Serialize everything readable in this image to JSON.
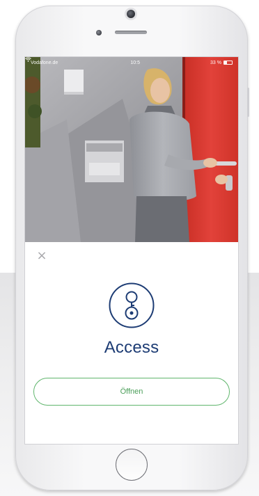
{
  "status_bar": {
    "carrier": "Vodafone.de",
    "wifi_icon": "wifi-icon",
    "time": "10:5",
    "battery_percent": "33 %",
    "battery_level": 0.33
  },
  "dialog": {
    "close_label": "×",
    "key_icon": "key-icon",
    "title": "Access",
    "open_button_label": "Öffnen"
  },
  "colors": {
    "title": "#1d3c74",
    "accent_green": "#5fb56c",
    "door_red": "#d9392f"
  }
}
